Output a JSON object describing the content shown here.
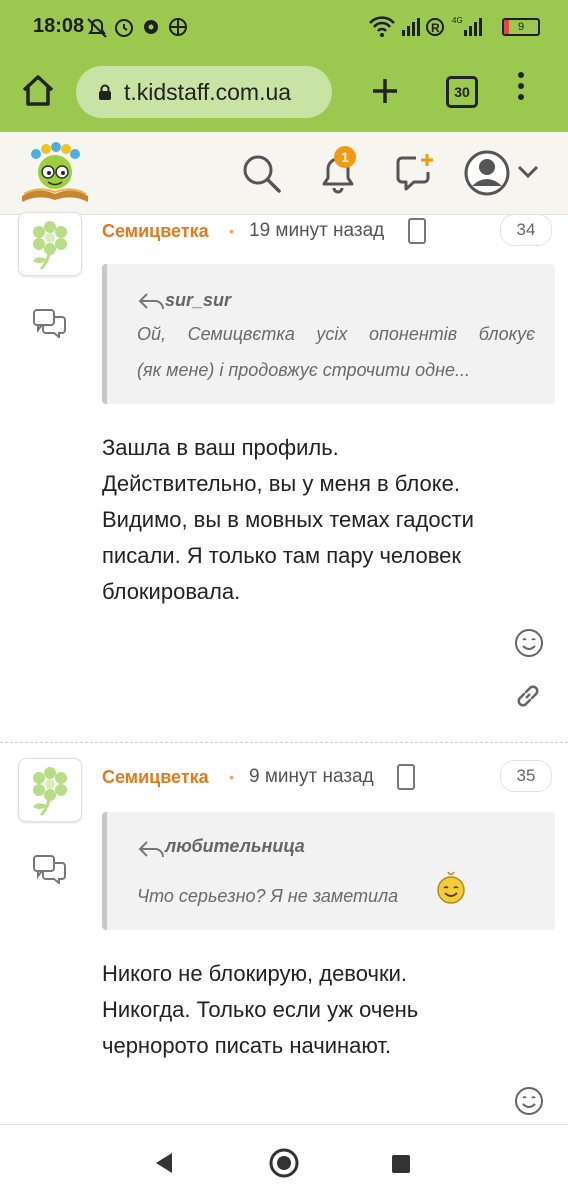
{
  "status_bar": {
    "time": "18:08",
    "battery_level": "9"
  },
  "browser": {
    "url": "t.kidstaff.com.ua",
    "tab_count": "30"
  },
  "header": {
    "notifications_count": "1"
  },
  "posts": [
    {
      "author": "Семицветка",
      "time": "19 минут назад",
      "number": "34",
      "quote_author": "sur_sur",
      "quote_line1": "Ой, Семицвєтка усіх опонентів блокує",
      "quote_line2": "(як мене) і продовжує строчити одне...",
      "body": [
        "Зашла в ваш профиль.",
        "Действительно, вы у меня в блоке.",
        "Видимо, вы в мовных темах гадости",
        "писали. Я только там пару человек",
        "блокировала."
      ]
    },
    {
      "author": "Семицветка",
      "time": "9 минут назад",
      "number": "35",
      "quote_author": "любительница",
      "quote_line1": "Что серьезно? Я не заметила",
      "body": [
        "Никого не блокирую, девочки.",
        "Никогда. Только если уж очень",
        "черноротo писать начинают."
      ]
    }
  ],
  "colors": {
    "brand_green": "#9bc94f",
    "author_orange": "#e07c1d",
    "badge_orange": "#f39a12"
  }
}
